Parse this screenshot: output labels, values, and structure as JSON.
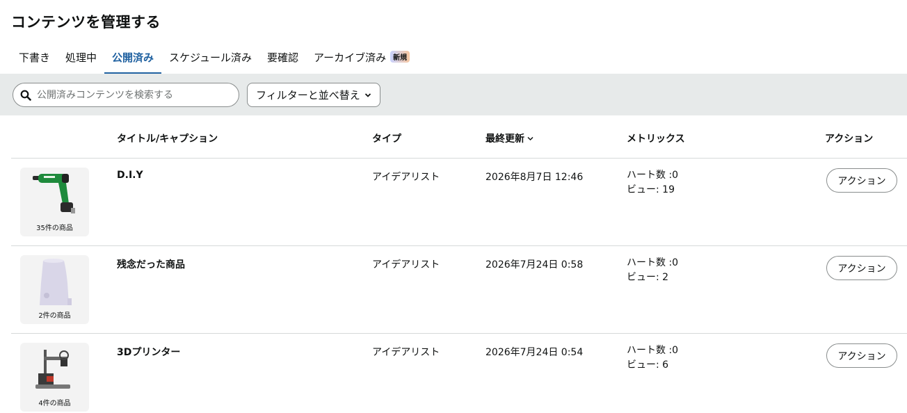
{
  "page": {
    "title": "コンテンツを管理する"
  },
  "tabs": [
    {
      "label": "下書き"
    },
    {
      "label": "処理中"
    },
    {
      "label": "公開済み",
      "active": true
    },
    {
      "label": "スケジュール済み"
    },
    {
      "label": "要確認"
    },
    {
      "label": "アーカイブ済み",
      "badge": "新規"
    }
  ],
  "toolbar": {
    "search_placeholder": "公開済みコンテンツを検索する",
    "filter_label": "フィルターと並べ替え"
  },
  "table": {
    "headers": {
      "title": "タイトル/キャプション",
      "type": "タイプ",
      "updated": "最終更新",
      "metrics": "メトリックス",
      "action": "アクション"
    },
    "rows": [
      {
        "thumb_caption": "35件の商品",
        "thumb_icon": "power-tool-image",
        "title": "D.I.Y",
        "type": "アイデアリスト",
        "updated": "2026年8月7日 12:46",
        "hearts": "ハート数 :0",
        "views": "ビュー: 19",
        "action_label": "アクション"
      },
      {
        "thumb_caption": "2件の商品",
        "thumb_icon": "humidifier-image",
        "title": "残念だった商品",
        "type": "アイデアリスト",
        "updated": "2026年7月24日 0:58",
        "hearts": "ハート数 :0",
        "views": "ビュー: 2",
        "action_label": "アクション"
      },
      {
        "thumb_caption": "4件の商品",
        "thumb_icon": "3d-printer-image",
        "title": "3Dプリンター",
        "type": "アイデアリスト",
        "updated": "2026年7月24日 0:54",
        "hearts": "ハート数 :0",
        "views": "ビュー: 6",
        "action_label": "アクション"
      }
    ]
  },
  "colors": {
    "accent": "#2162a1",
    "toolbar_bg": "#e7eaea",
    "border": "#d5d9d9"
  }
}
